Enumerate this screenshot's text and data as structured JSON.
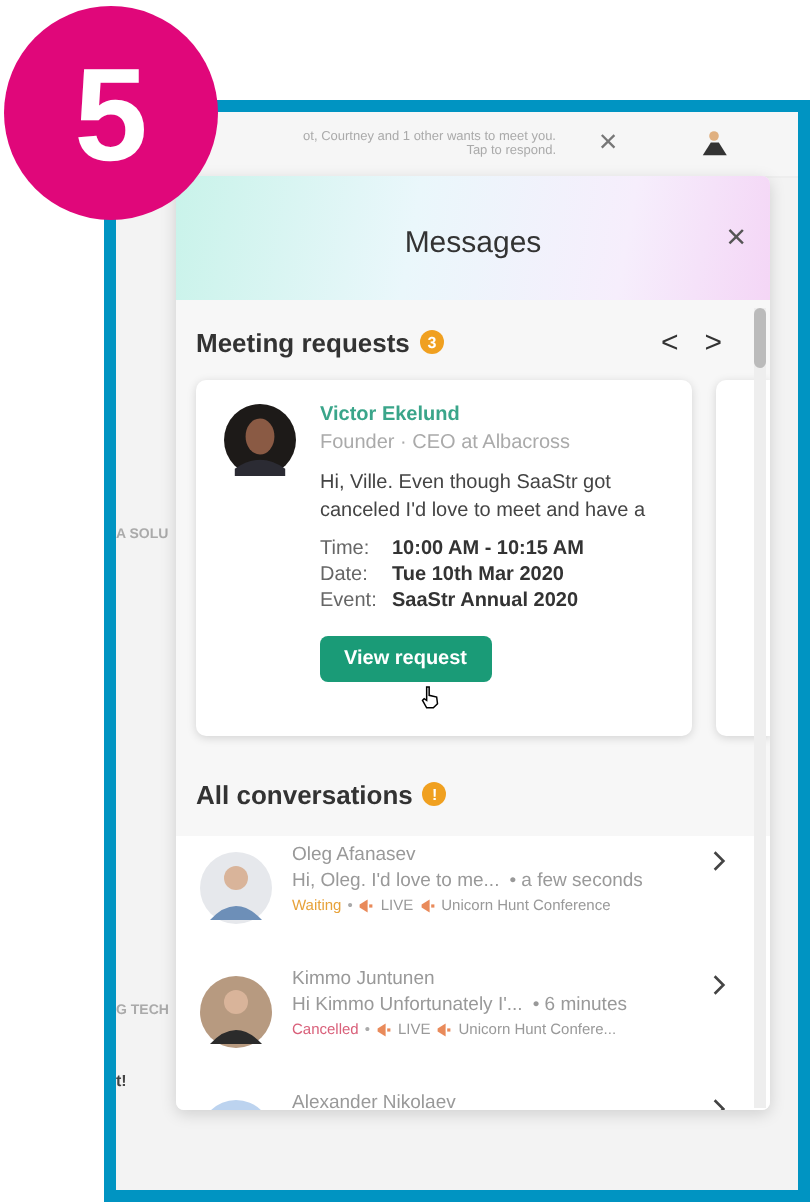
{
  "step_badge": "5",
  "background": {
    "notification": {
      "text": "ot, Courtney and 1 other wants to meet you.",
      "hint": "Tap to respond.",
      "close": "×"
    },
    "fragments": [
      "A SOLU",
      "G TECH",
      "t!"
    ]
  },
  "panel": {
    "title": "Messages",
    "close": "×",
    "meeting_requests": {
      "title": "Meeting requests",
      "count": "3",
      "prev": "<",
      "next": ">",
      "card": {
        "name": "Victor Ekelund",
        "role": "Founder · CEO at Albacross",
        "message": "Hi, Ville. Even though SaaStr got canceled I'd love to meet and have a",
        "details": [
          {
            "label": "Time:",
            "value": "10:00 AM - 10:15 AM"
          },
          {
            "label": "Date:",
            "value": "Tue 10th Mar 2020"
          },
          {
            "label": "Event:",
            "value": "SaaStr Annual 2020"
          }
        ],
        "button": "View request"
      }
    },
    "conversations": {
      "title": "All conversations",
      "alert": "!",
      "items": [
        {
          "name": "Oleg Afanasev",
          "preview": "Hi, Oleg. I'd love to me...",
          "time": "• a few seconds",
          "status": "Waiting",
          "separator": "•",
          "kind": "waiting",
          "live": "LIVE",
          "event": "Unicorn Hunt Conference"
        },
        {
          "name": "Kimmo Juntunen",
          "preview": "Hi Kimmo Unfortunately I'...",
          "time": "• 6 minutes",
          "status": "Cancelled",
          "separator": "•",
          "kind": "cancelled",
          "live": "LIVE",
          "event": "Unicorn Hunt Confere..."
        },
        {
          "name": "Alexander Nikolaev",
          "kind": "partial"
        }
      ]
    }
  }
}
